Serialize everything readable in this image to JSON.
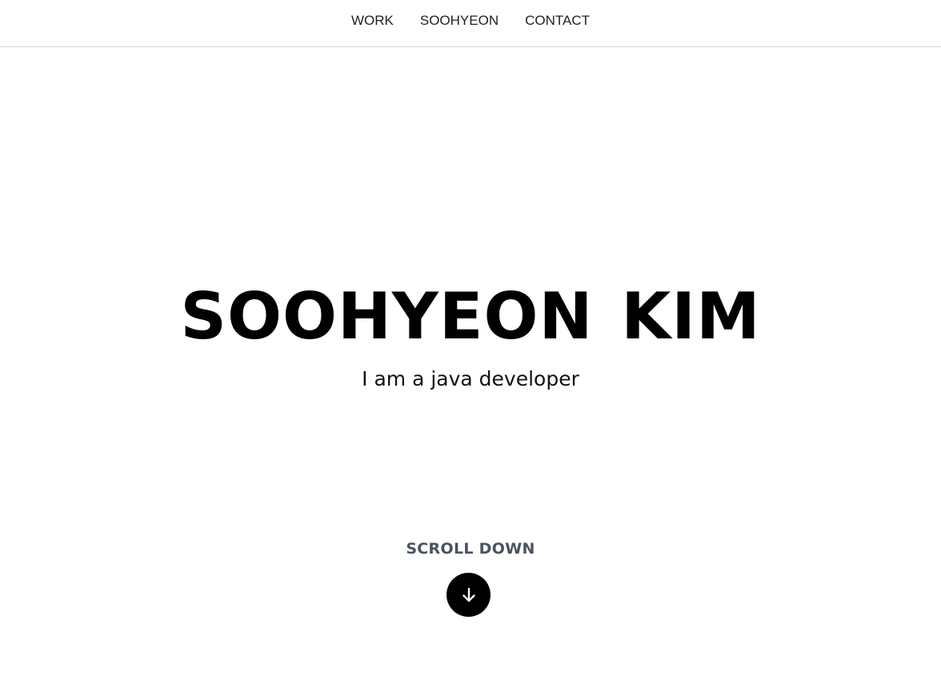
{
  "nav": {
    "items": [
      {
        "label": "WORK"
      },
      {
        "label": "SOOHYEON"
      },
      {
        "label": "CONTACT"
      }
    ]
  },
  "hero": {
    "title": "SOOHYEON KIM",
    "subtitle": "I am a java developer"
  },
  "scroll": {
    "label": "SCROLL DOWN",
    "icon": "arrow-down-icon"
  },
  "colors": {
    "background": "#ffffff",
    "text": "#000000",
    "scroll_label": "#4a5260",
    "nav_border": "#d9d9d9",
    "button": "#000000",
    "button_icon": "#ffffff"
  }
}
